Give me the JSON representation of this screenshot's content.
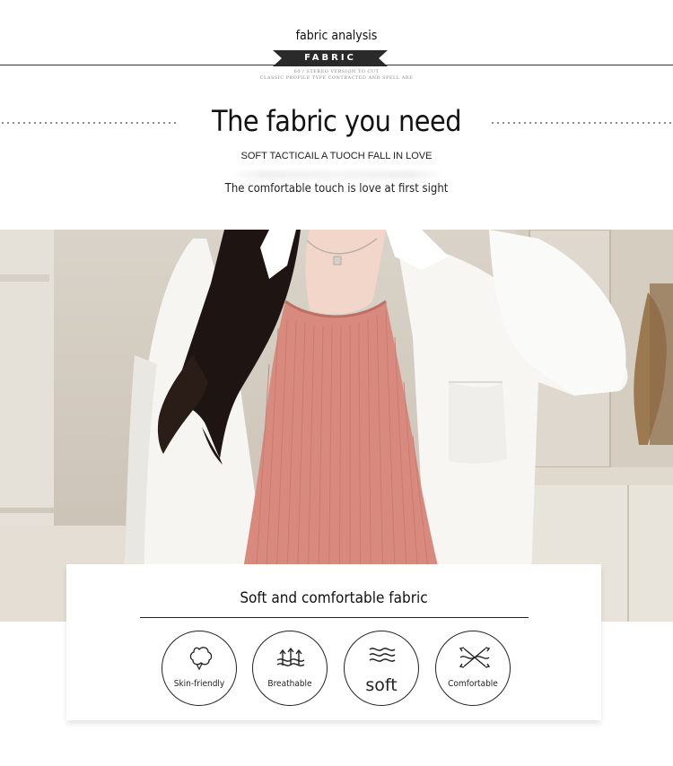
{
  "header": {
    "eyebrow": "fabric analysis",
    "badge": "FABRIC",
    "fine_print_1": "60 / STEREO VERSION TO CUT",
    "fine_print_2": "CLASSIC PROFILE TYPE CONTRACTED AND SPELL ARE",
    "title": "The fabric you need",
    "subtitle": "SOFT TACTICAIL A TUOCH FALL IN LOVE",
    "tagline": "The comfortable touch is love at first sight"
  },
  "colors": {
    "badge_bg": "#2a2a2a",
    "tank_top": "#d98a7e",
    "shirt": "#f6f5f2",
    "hair": "#1e1512"
  },
  "card": {
    "title": "Soft and comfortable fabric",
    "features": [
      {
        "icon": "cotton-flower-icon",
        "label": "Skin-friendly"
      },
      {
        "icon": "breathable-arrows-icon",
        "label": "Breathable"
      },
      {
        "icon": "waves-icon",
        "label": "soft"
      },
      {
        "icon": "fabric-stretch-icon",
        "label": "Comfortable"
      }
    ]
  }
}
